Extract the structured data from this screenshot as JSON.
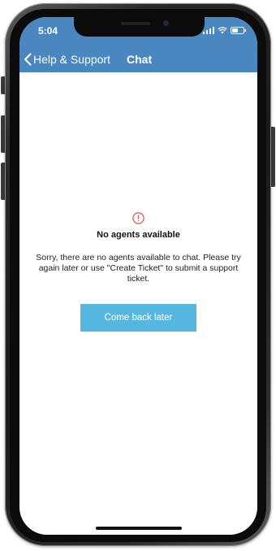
{
  "status_bar": {
    "time": "5:04",
    "icons": [
      "cellular-signal-icon",
      "wifi-icon",
      "battery-icon"
    ]
  },
  "nav": {
    "back_label": "Help & Support",
    "title": "Chat",
    "back_icon": "chevron-left-icon"
  },
  "empty_state": {
    "icon": "alert-circle-icon",
    "title": "No agents available",
    "message": "Sorry, there are no agents available to chat. Please try again later or use \"Create Ticket\" to submit a support ticket.",
    "button_label": "Come back later"
  },
  "colors": {
    "header_bg": "#4a86c0",
    "button_bg": "#55b6e0",
    "alert": "#d9534f"
  }
}
